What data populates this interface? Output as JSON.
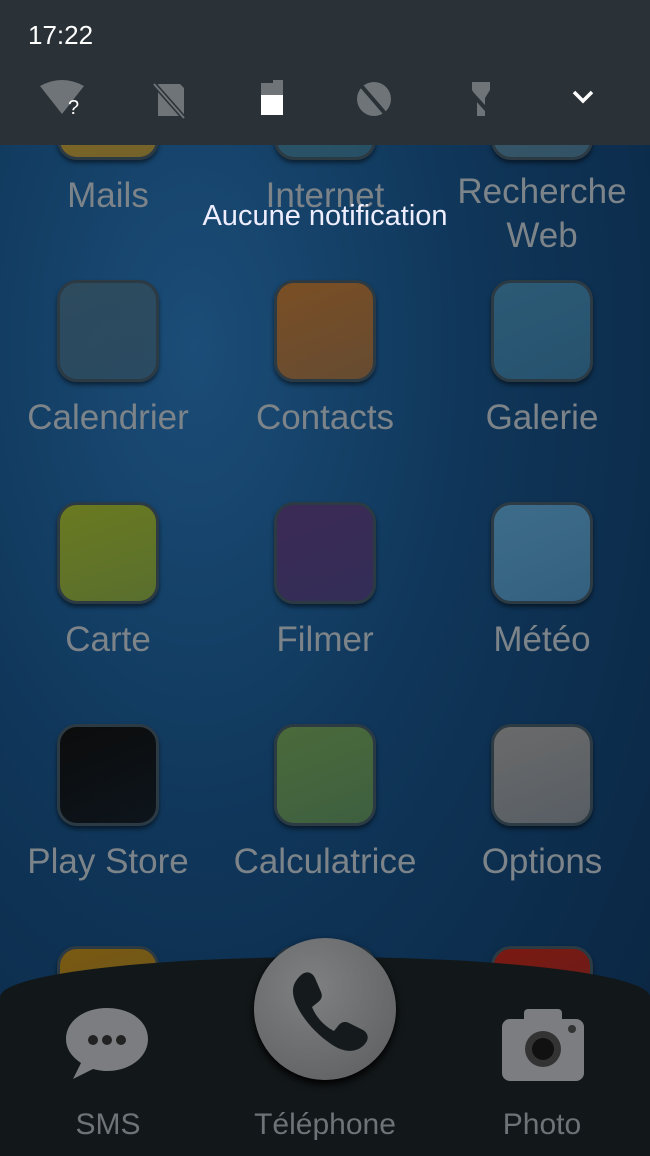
{
  "status": {
    "time": "17:22"
  },
  "quick_settings": [
    {
      "icon": "wifi-unknown-icon"
    },
    {
      "icon": "no-sim-icon"
    },
    {
      "icon": "battery-icon",
      "level": 0.6
    },
    {
      "icon": "rotation-off-icon"
    },
    {
      "icon": "flashlight-off-icon"
    },
    {
      "icon": "chevron-down-icon"
    }
  ],
  "notifications": {
    "empty_text": "Aucune notification"
  },
  "apps": [
    {
      "label": "Mails",
      "color": "#8a6a1c"
    },
    {
      "label": "Internet",
      "color": "#2d5566"
    },
    {
      "label": "Recherche Web",
      "color": "#3b5a6a"
    },
    {
      "label": "Calendrier",
      "color": "#2e4b5e"
    },
    {
      "label": "Contacts",
      "color": "#7a4e24"
    },
    {
      "label": "Galerie",
      "color": "#2c5a75"
    },
    {
      "label": "Carte",
      "color": "#6a7a20"
    },
    {
      "label": "Filmer",
      "color": "#3b2a55"
    },
    {
      "label": "Météo",
      "color": "#3d6c8a"
    },
    {
      "label": "Play Store",
      "color": "#0c0c0c"
    },
    {
      "label": "Calculatrice",
      "color": "#4a6a3a"
    },
    {
      "label": "Options",
      "color": "#6a6a6a"
    },
    {
      "label": "",
      "color": "#7a5a12"
    },
    {
      "label": "",
      "color": "#7a1a12"
    },
    {
      "label": "",
      "color": "#7a1a12"
    }
  ],
  "dock": {
    "sms": "SMS",
    "phone": "Téléphone",
    "photo": "Photo"
  }
}
